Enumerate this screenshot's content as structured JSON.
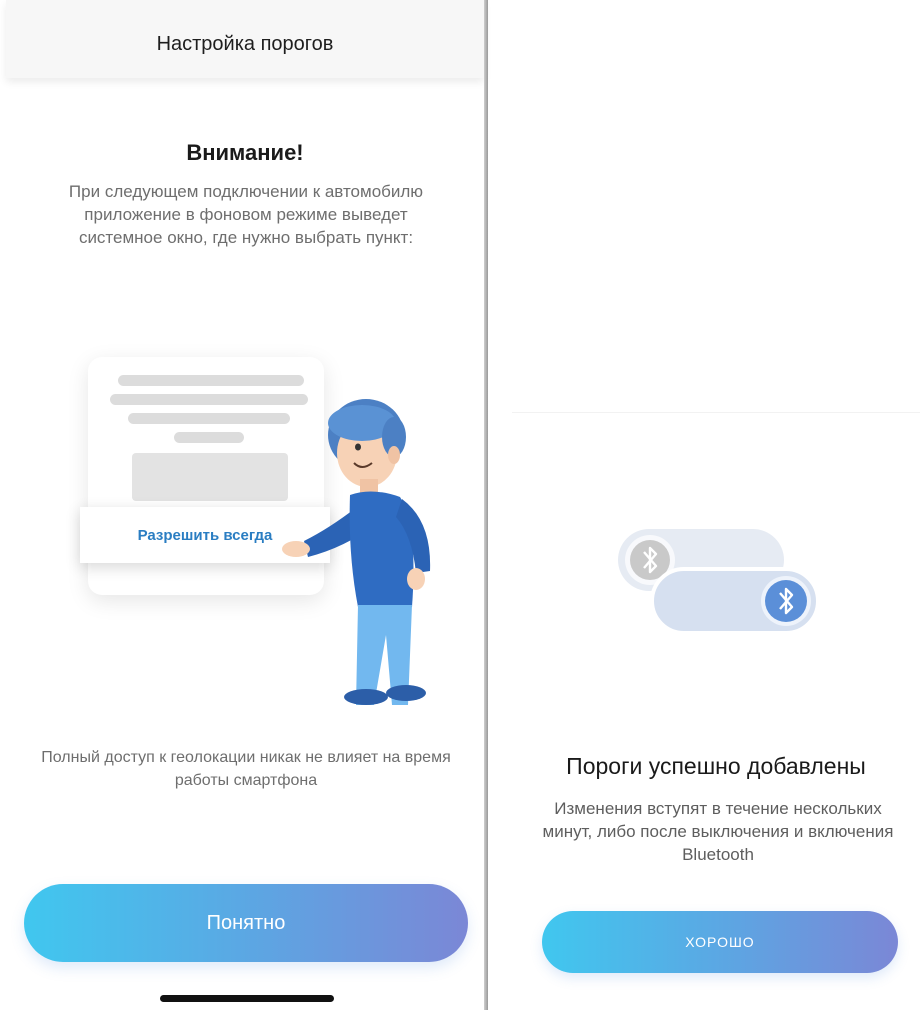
{
  "left_screen": {
    "nav_title": "Настройка порогов",
    "heading": "Внимание!",
    "paragraph": "При следующем подключении к автомобилю приложение в фоновом режиме выведет системное окно, где нужно выбрать пункт:",
    "illustration": {
      "allow_option": "Разрешить всегда",
      "character": "man-pointing-illustration"
    },
    "footer_note": "Полный доступ к геолокации никак не влияет на время работы смартфона",
    "primary_button": "Понятно"
  },
  "right_dialog": {
    "icon": "bluetooth-toggle-icon",
    "title": "Пороги успешно добавлены",
    "message": "Изменения вступят в течение нескольких минут, либо после выключения и включения Bluetooth",
    "ok_button": "ХОРОШО"
  },
  "colors": {
    "button_gradient_start": "#40c7ef",
    "button_gradient_end": "#7b87d6",
    "link_blue": "#2a7dc2",
    "text_primary": "#1a1a1a",
    "text_secondary": "#6e6e6e"
  }
}
